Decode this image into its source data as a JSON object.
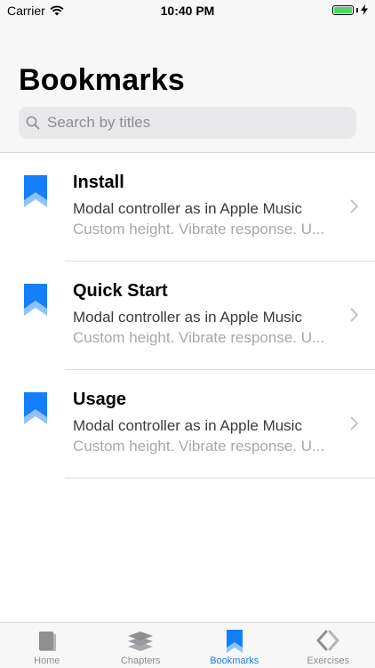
{
  "status_bar": {
    "carrier": "Carrier",
    "time": "10:40 PM"
  },
  "header": {
    "title": "Bookmarks"
  },
  "search": {
    "placeholder": "Search by titles",
    "value": ""
  },
  "list": {
    "items": [
      {
        "title": "Install",
        "subtitle": "Modal controller as in Apple Music",
        "description": "Custom height. Vibrate response. U..."
      },
      {
        "title": "Quick Start",
        "subtitle": "Modal controller as in Apple Music",
        "description": "Custom height. Vibrate response. U..."
      },
      {
        "title": "Usage",
        "subtitle": "Modal controller as in Apple Music",
        "description": "Custom height. Vibrate response. U..."
      }
    ]
  },
  "tabbar": {
    "tabs": [
      {
        "label": "Home",
        "icon": "book-icon",
        "active": false
      },
      {
        "label": "Chapters",
        "icon": "layers-icon",
        "active": false
      },
      {
        "label": "Bookmarks",
        "icon": "bookmark-icon",
        "active": true
      },
      {
        "label": "Exercises",
        "icon": "code-icon",
        "active": false
      }
    ]
  },
  "colors": {
    "accent": "#147efb",
    "bookmark_light": "#8fc3ff",
    "inactive": "#8e8e93"
  }
}
